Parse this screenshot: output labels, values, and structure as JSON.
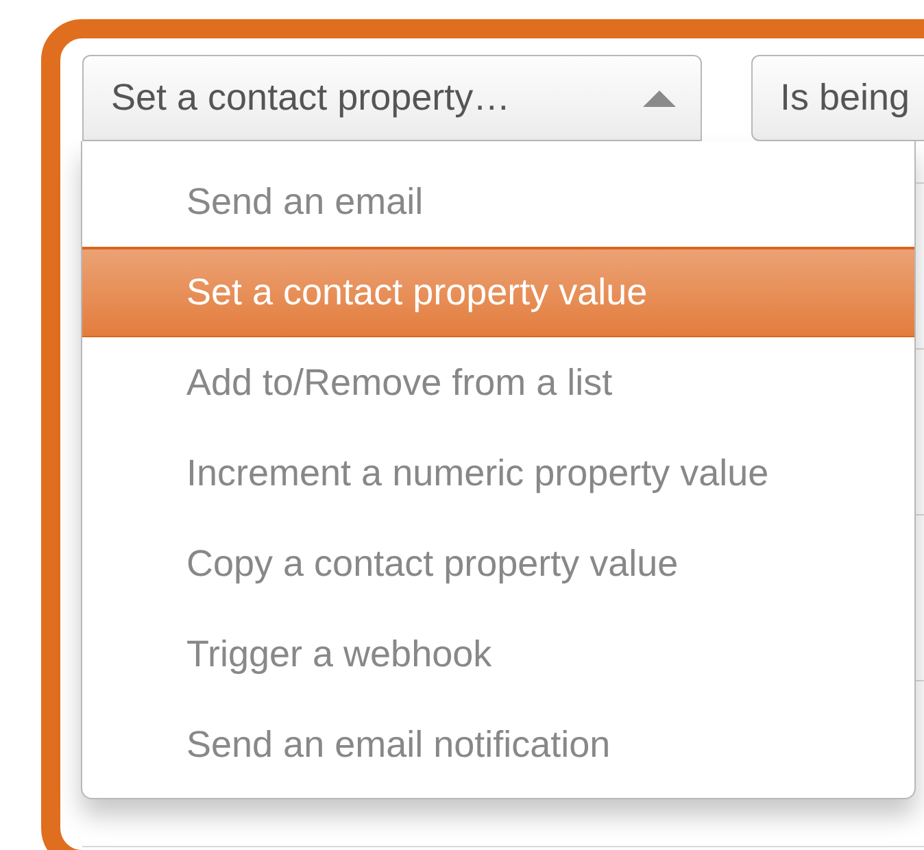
{
  "action_select": {
    "value": "Set a contact property…",
    "expanded": true
  },
  "condition_select": {
    "value": "Is being"
  },
  "menu": {
    "items": [
      {
        "label": "Send an email",
        "selected": false
      },
      {
        "label": "Set a contact property value",
        "selected": true
      },
      {
        "label": "Add to/Remove from a list",
        "selected": false
      },
      {
        "label": "Increment a numeric property value",
        "selected": false
      },
      {
        "label": "Copy a contact property value",
        "selected": false
      },
      {
        "label": "Trigger a webhook",
        "selected": false
      },
      {
        "label": "Send an email notification",
        "selected": false
      }
    ]
  }
}
